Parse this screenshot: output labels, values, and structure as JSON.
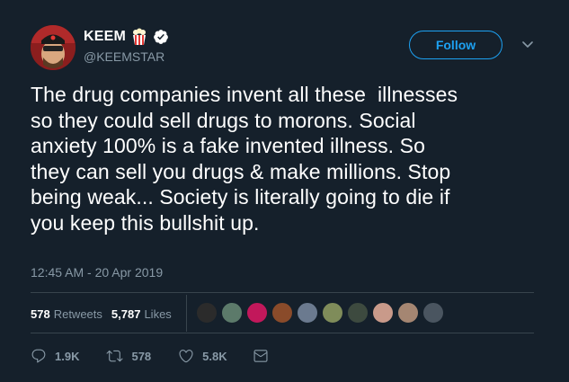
{
  "user": {
    "display_name": "KEEM",
    "handle": "@KEEMSTAR",
    "verified": true,
    "name_emoji": "popcorn"
  },
  "header": {
    "follow_label": "Follow"
  },
  "tweet": {
    "lines": [
      "The drug companies invent all these  illnesses",
      "so they could sell drugs to morons. Social",
      "anxiety 100% is a fake invented illness. So",
      "they can sell you drugs & make millions. Stop",
      "being weak... Society is literally going to die if",
      "you keep this bullshit up."
    ],
    "timestamp": "12:45 AM - 20 Apr 2019"
  },
  "stats": {
    "retweets_count": "578",
    "retweets_label": "Retweets",
    "likes_count": "5,787",
    "likes_label": "Likes"
  },
  "likers": [
    {
      "name": "liker-1",
      "color": "#2b2b2b"
    },
    {
      "name": "liker-2",
      "color": "#5c7a6a"
    },
    {
      "name": "liker-3",
      "color": "#c2185b"
    },
    {
      "name": "liker-4",
      "color": "#8a4b2a"
    },
    {
      "name": "liker-5",
      "color": "#6b7a8f"
    },
    {
      "name": "liker-6",
      "color": "#7f8c5a"
    },
    {
      "name": "liker-7",
      "color": "#3d4a3f"
    },
    {
      "name": "liker-8",
      "color": "#c99a8a"
    },
    {
      "name": "liker-9",
      "color": "#a58672"
    },
    {
      "name": "liker-10",
      "color": "#4a5560"
    }
  ],
  "actions": {
    "replies": "1.9K",
    "retweets": "578",
    "likes": "5.8K"
  },
  "colors": {
    "background": "#15202b",
    "accent": "#1da1f2",
    "muted": "#8899a6",
    "divider": "#38444d"
  }
}
